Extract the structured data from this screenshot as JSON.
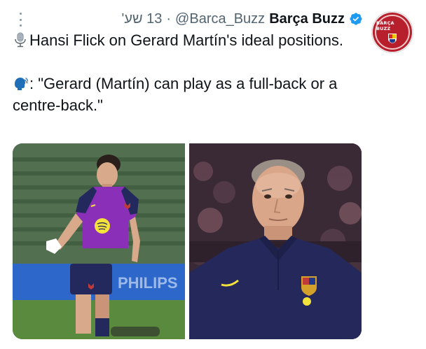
{
  "tweet": {
    "display_name": "Barça Buzz",
    "handle": "@Barca_Buzz",
    "separator": "·",
    "time": "13 שע'",
    "text_line1": "Hansi Flick on Gerard Martín's ideal positions.",
    "text_line2": ": \"Gerard (Martín) can play as a full-back or a centre-back.\""
  },
  "avatar": {
    "label": "BARÇA BUZZ",
    "bg_color": "#b81f2d"
  },
  "media": {
    "left_ad_text": "PHILIPS",
    "count": 2
  },
  "icons": {
    "verified": "verified-badge-icon",
    "microphone": "microphone-icon",
    "speaking_head": "speaking-head-icon",
    "more": "more-options-icon"
  },
  "colors": {
    "verified_blue": "#1d9bf0",
    "text_primary": "#0f1419",
    "text_secondary": "#536471",
    "barca_red": "#b81f2d",
    "kit_purple": "#8a2fb8",
    "kit_navy": "#23295c"
  }
}
